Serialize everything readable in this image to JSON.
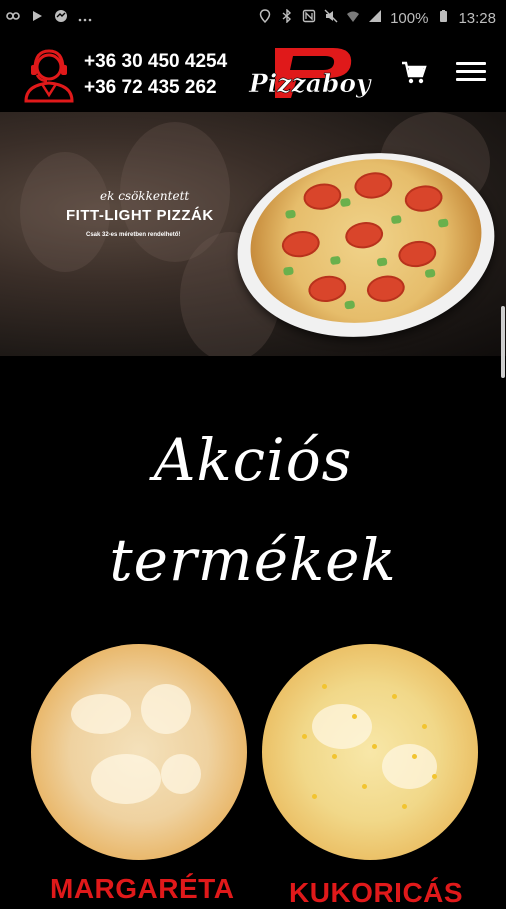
{
  "status_bar": {
    "battery": "100%",
    "time": "13:28",
    "left_icons": [
      "link-icon",
      "play-icon",
      "messenger-icon",
      "more-icon"
    ],
    "right_icons": [
      "location-icon",
      "bluetooth-icon",
      "nfc-icon",
      "mute-icon",
      "wifi-icon",
      "signal-icon",
      "battery-icon"
    ]
  },
  "header": {
    "phone_1": "+36 30 450 4254",
    "phone_2": "+36 72 435 262",
    "logo_text": "Pizzaboy",
    "colors": {
      "accent": "#e0191a",
      "background": "#000000"
    }
  },
  "banner": {
    "subtitle": "ek csökkentett",
    "title": "FITT-LIGHT PIZZÁK",
    "note": "Csak 32-es méretben rendelhető!"
  },
  "section": {
    "title_line1": "Akciós",
    "title_line2": "termékek"
  },
  "products": [
    {
      "name": "MARGARÉTA"
    },
    {
      "name": "KUKORICÁS"
    }
  ]
}
